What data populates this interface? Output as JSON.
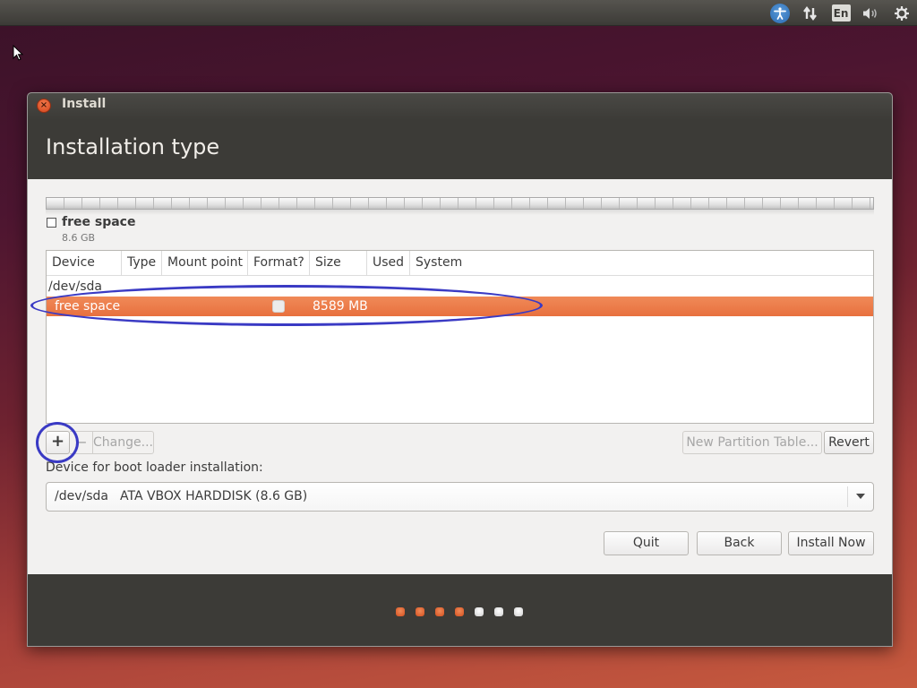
{
  "top_panel": {
    "indicators": [
      {
        "name": "accessibility-icon"
      },
      {
        "name": "network-icon"
      },
      {
        "name": "keyboard-layout",
        "label": "En"
      },
      {
        "name": "volume-icon"
      },
      {
        "name": "system-gear-icon"
      }
    ]
  },
  "window": {
    "title": "Install",
    "page_title": "Installation type"
  },
  "partition_bar": {
    "legend_label": "free space",
    "legend_size": "8.6 GB"
  },
  "table": {
    "columns": [
      "Device",
      "Type",
      "Mount point",
      "Format?",
      "Size",
      "Used",
      "System"
    ],
    "rows": [
      {
        "device": "/dev/sda",
        "type": "",
        "mount": "",
        "format": "",
        "size": "",
        "used": "",
        "system": "",
        "selected": false
      },
      {
        "device": "free space",
        "type": "",
        "mount": "",
        "format": false,
        "size": "8589 MB",
        "used": "",
        "system": "",
        "selected": true
      }
    ]
  },
  "actions": {
    "add": "+",
    "remove": "−",
    "change": "Change...",
    "new_partition_table": "New Partition Table...",
    "revert": "Revert"
  },
  "boot_loader": {
    "label": "Device for boot loader installation:",
    "selected_device": "/dev/sda",
    "selected_description": "ATA VBOX HARDDISK (8.6 GB)"
  },
  "nav": {
    "quit": "Quit",
    "back": "Back",
    "install_now": "Install Now"
  },
  "progress": {
    "total_steps": 7,
    "completed_steps": 4
  },
  "colors": {
    "accent": "#e8703e",
    "annotation": "#3a3ac4",
    "titlebar": "#3c3b37"
  }
}
